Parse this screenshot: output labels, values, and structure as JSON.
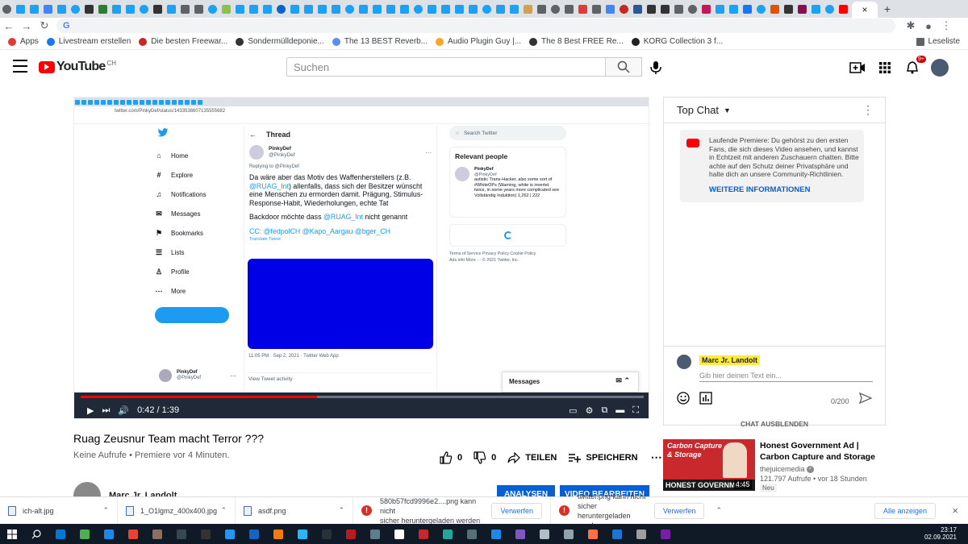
{
  "browser": {
    "tab_favicon_colors": [
      "#5f6368",
      "#1da1f2",
      "#1da1f2",
      "#4285f4",
      "#1da1f2",
      "#1da1f2",
      "#333333",
      "#2e7d32",
      "#1da1f2",
      "#1da1f2",
      "#1da1f2",
      "#333333",
      "#1da1f2",
      "#5f6368",
      "#5f6368",
      "#1da1f2",
      "#8bc34a",
      "#1da1f2",
      "#1da1f2",
      "#1da1f2",
      "#0a66c2",
      "#1da1f2",
      "#1da1f2",
      "#1da1f2",
      "#1da1f2",
      "#1da1f2",
      "#1da1f2",
      "#1da1f2",
      "#1da1f2",
      "#1da1f2",
      "#1da1f2",
      "#1da1f2",
      "#1da1f2",
      "#1da1f2",
      "#1da1f2",
      "#1da1f2",
      "#1da1f2",
      "#1da1f2",
      "#d4a04a",
      "#5f6368",
      "#5f6368",
      "#5f6368",
      "#e53935",
      "#5f6368",
      "#4285f4",
      "#c62828",
      "#2b579a",
      "#333333",
      "#333333",
      "#5f6368",
      "#5f6368",
      "#c2185b",
      "#1da1f2",
      "#1da1f2",
      "#1877f2",
      "#1da1f2",
      "#e65100",
      "#333333",
      "#880e4f",
      "#1da1f2",
      "#1da1f2",
      "#ff0000"
    ],
    "active_tab_close": "×",
    "new_tab": "+",
    "omnibox_text": "G",
    "bookmarks": [
      {
        "label": "Apps",
        "color": "#e53935"
      },
      {
        "label": "Livestream erstellen",
        "color": "#1877f2"
      },
      {
        "label": "Die besten Freewar...",
        "color": "#c62828"
      },
      {
        "label": "Sondermülldeponie...",
        "color": "#333333"
      },
      {
        "label": "The 13 BEST Reverb...",
        "color": "#5b8def"
      },
      {
        "label": "Audio Plugin Guy |...",
        "color": "#f9a825"
      },
      {
        "label": "The 8 Best FREE Re...",
        "color": "#333333"
      },
      {
        "label": "KORG Collection 3 f...",
        "color": "#222222"
      }
    ],
    "reading_list": "Leseliste"
  },
  "youtube": {
    "logo_text": "YouTube",
    "country_code": "CH",
    "search_placeholder": "Suchen",
    "notification_badge": "9+",
    "brand_red": "#ff0000",
    "link_blue": "#065fd4"
  },
  "video": {
    "tweet": {
      "url": "twitter.com/PinkyDef/status/1433536607135555682",
      "nav": [
        "Home",
        "Explore",
        "Notifications",
        "Messages",
        "Bookmarks",
        "Lists",
        "Profile",
        "More"
      ],
      "thread_label": "Thread",
      "author": "PinkyDef",
      "handle": "@PinkyDef",
      "replying_to": "Replying to @PinkyDef",
      "body_1": "Da wäre aber das Motiv des Waffenherstellers (z.B. @RUAG_Int) allenfalls, dass sich der Besitzer wünscht eine Menschen zu ermorden damit. Prägung, Stimulus-Response-Habit, Wiederholungen, echte Tat",
      "body_2": "Backdoor möchte dass @RUAG_Int nicht genannt",
      "body_3": "CC: @fedpolCH @Kapo_Aargau @bger_CH",
      "translate": "Translate Tweet",
      "timestamp": "11:05 PM · Sep 2, 2021 · Twitter Web App",
      "view_activity": "View Tweet activity",
      "search_placeholder": "Search Twitter",
      "relevant_people": "Relevant people",
      "person_name": "PinkyDef",
      "person_handle": "@PinkyDef",
      "person_bio": "autistic Trans-Hacker, also some sort of #WhiteOPs (Warning, white is invertet twice, in some years more complicated see Vollständig Induktion) 1,262 | 222",
      "footer_links": "Terms of Service   Privacy Policy   Cookie Policy\nAds info   More ···   © 2021 Twitter, Inc.",
      "sidebar_user": "PinkyDef",
      "sidebar_handle": "@PinkyDef",
      "messages": "Messages"
    },
    "time": "0:42 / 1:39",
    "progress": 0.42
  },
  "below": {
    "title": "Ruag Zeusnur Team macht Terror ???",
    "meta": "Keine Aufrufe • Premiere vor 4 Minuten.",
    "likes": "0",
    "dislikes": "0",
    "share": "TEILEN",
    "save": "SPEICHERN",
    "channel": "Marc Jr. Landolt",
    "analysen": "ANALYSEN",
    "edit": "VIDEO BEARBEITEN"
  },
  "chat": {
    "header": "Top Chat",
    "notice": "Laufende Premiere: Du gehörst zu den ersten Fans, die sich dieses Video ansehen, und kannst in Echtzeit mit anderen Zuschauern chatten. Bitte achte auf den Schutz deiner Privatsphäre und halte dich an unsere Community-Richtlinien.",
    "more_info": "WEITERE INFORMATIONEN",
    "user": "Marc Jr. Landolt",
    "input_placeholder": "Gib hier deinen Text ein...",
    "counter": "0/200",
    "hide": "CHAT AUSBLENDEN"
  },
  "recommendation": {
    "thumb_line1": "Carbon Capture",
    "thumb_line2": "& Storage",
    "thumb_banner": "HONEST GOVERNMENT",
    "duration": "4:45",
    "title": "Honest Government Ad | Carbon Capture and Storage",
    "channel": "thejuicemedia",
    "meta": "121.797 Aufrufe • vor 18 Stunden",
    "badge": "Neu"
  },
  "downloads": {
    "items": [
      {
        "name": "ich-alt.jpg"
      },
      {
        "name": "1_O1lgmz_400x400.jpg"
      },
      {
        "name": "asdf.png"
      }
    ],
    "warnings": [
      {
        "line1": "580b57fcd9996e2....png kann nicht",
        "line2": "sicher heruntergeladen werden",
        "button": "Verwerfen"
      },
      {
        "line1": "twitter.png kann nicht sicher",
        "line2": "heruntergeladen werden",
        "button": "Verwerfen"
      }
    ],
    "show_all": "Alle anzeigen",
    "close": "×"
  },
  "taskbar": {
    "icon_colors": [
      "#0078d4",
      "#4caf50",
      "#1e88e5",
      "#ea4335",
      "#8d6e63",
      "#37474f",
      "#333333",
      "#2196f3",
      "#1565c0",
      "#f57c00",
      "#29b6f6",
      "#263238",
      "#b71c1c",
      "#607d8b",
      "#ffffff",
      "#c62828",
      "#26a69a",
      "#546e7a",
      "#1e88e5",
      "#7e57c2",
      "#b0bec5",
      "#90a4ae",
      "#ff7043",
      "#1976d2",
      "#9e9e9e",
      "#7b1fa2"
    ],
    "time": "23:17",
    "date": "02.09.2021"
  }
}
